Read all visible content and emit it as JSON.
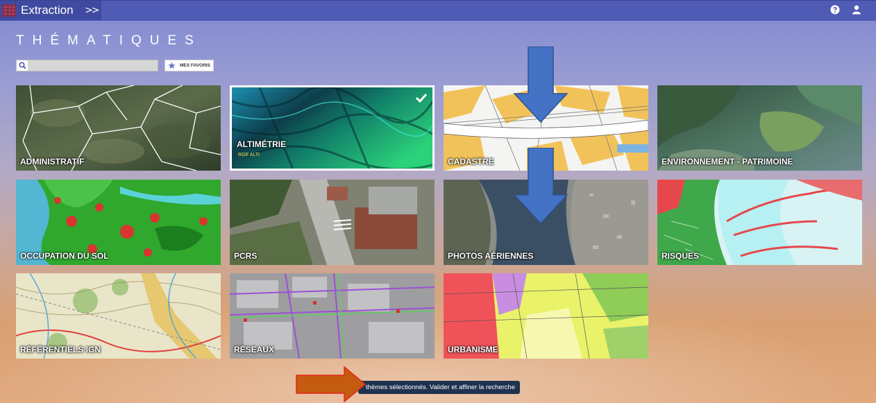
{
  "app": {
    "title": "Extraction",
    "toggle": ">>"
  },
  "page": {
    "title": "THÉMATIQUES"
  },
  "search": {
    "placeholder": "",
    "value": ""
  },
  "favorites": {
    "label": "MES FAVORIS"
  },
  "tiles": [
    {
      "label": "ADMINISTRATIF"
    },
    {
      "label": "ALTIMÉTRIE",
      "sublabel": "RGE ALTI",
      "selected": true
    },
    {
      "label": "CADASTRE"
    },
    {
      "label": "ENVIRONNEMENT - PATRIMOINE"
    },
    {
      "label": "OCCUPATION DU SOL"
    },
    {
      "label": "PCRS"
    },
    {
      "label": "PHOTOS AÉRIENNES"
    },
    {
      "label": "RISQUES"
    },
    {
      "label": "RÉFÉRENTIELS IGN"
    },
    {
      "label": "RÉSEAUX"
    },
    {
      "label": "URBANISME"
    }
  ],
  "footer": {
    "message": "thèmes sélectionnés. Valider et affiner la recherche"
  },
  "colors": {
    "topbar": "#4f5bb4",
    "annotation_blue": "#3f6fc4",
    "annotation_orange": "#c55a11",
    "footer_bg": "#1f3250"
  }
}
